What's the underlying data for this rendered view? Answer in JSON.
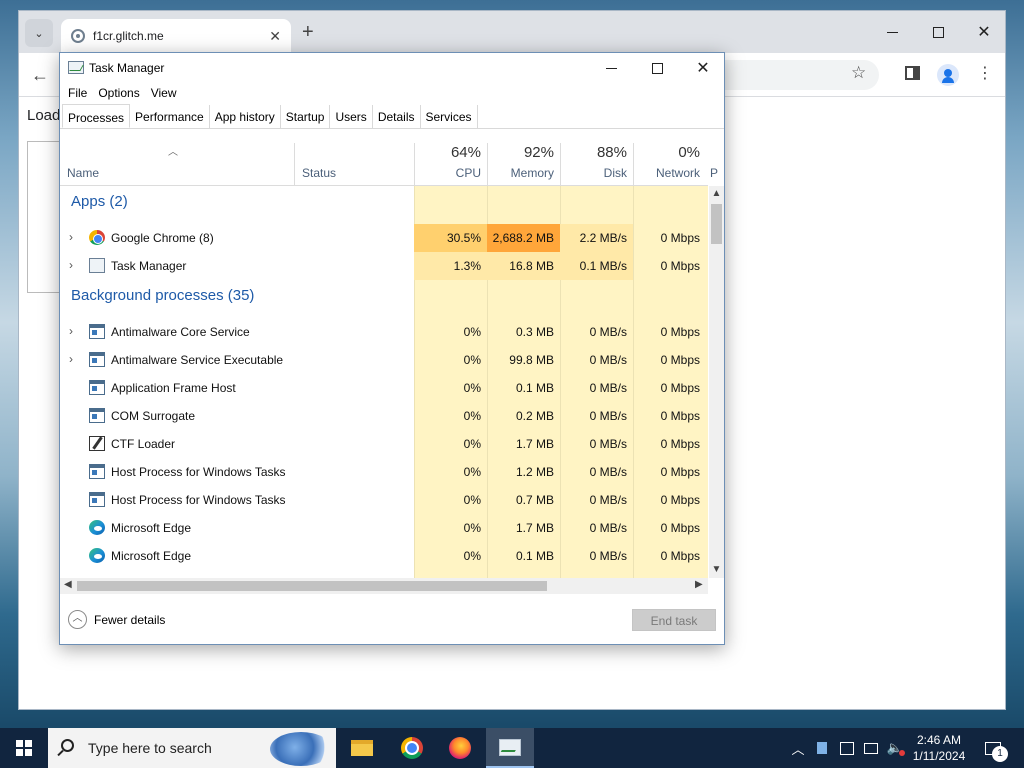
{
  "browser": {
    "tab_title": "f1cr.glitch.me",
    "tab_close": "✕",
    "new_tab": "+",
    "page_text": "Load"
  },
  "taskmgr": {
    "title": "Task Manager",
    "menu": [
      "File",
      "Options",
      "View"
    ],
    "tabs": [
      "Processes",
      "Performance",
      "App history",
      "Startup",
      "Users",
      "Details",
      "Services"
    ],
    "active_tab": "Processes",
    "columns": {
      "name": "Name",
      "status": "Status",
      "cpu": {
        "pct": "64%",
        "label": "CPU"
      },
      "memory": {
        "pct": "92%",
        "label": "Memory"
      },
      "disk": {
        "pct": "88%",
        "label": "Disk"
      },
      "network": {
        "pct": "0%",
        "label": "Network"
      },
      "power_partial": "P"
    },
    "groups": {
      "apps": "Apps (2)",
      "background": "Background processes (35)"
    },
    "apps": [
      {
        "name": "Google Chrome (8)",
        "icon": "chrome-icon",
        "expandable": true,
        "cpu": "30.5%",
        "memory": "2,688.2 MB",
        "disk": "2.2 MB/s",
        "network": "0 Mbps"
      },
      {
        "name": "Task Manager",
        "icon": "task-manager-icon",
        "expandable": true,
        "cpu": "1.3%",
        "memory": "16.8 MB",
        "disk": "0.1 MB/s",
        "network": "0 Mbps"
      }
    ],
    "background": [
      {
        "name": "Antimalware Core Service",
        "icon": "service-icon",
        "expandable": true,
        "cpu": "0%",
        "memory": "0.3 MB",
        "disk": "0 MB/s",
        "network": "0 Mbps"
      },
      {
        "name": "Antimalware Service Executable",
        "icon": "service-icon",
        "expandable": true,
        "cpu": "0%",
        "memory": "99.8 MB",
        "disk": "0 MB/s",
        "network": "0 Mbps"
      },
      {
        "name": "Application Frame Host",
        "icon": "service-icon",
        "expandable": false,
        "cpu": "0%",
        "memory": "0.1 MB",
        "disk": "0 MB/s",
        "network": "0 Mbps"
      },
      {
        "name": "COM Surrogate",
        "icon": "service-icon",
        "expandable": false,
        "cpu": "0%",
        "memory": "0.2 MB",
        "disk": "0 MB/s",
        "network": "0 Mbps"
      },
      {
        "name": "CTF Loader",
        "icon": "ctf-loader-icon",
        "expandable": false,
        "cpu": "0%",
        "memory": "1.7 MB",
        "disk": "0 MB/s",
        "network": "0 Mbps"
      },
      {
        "name": "Host Process for Windows Tasks",
        "icon": "service-icon",
        "expandable": false,
        "cpu": "0%",
        "memory": "1.2 MB",
        "disk": "0 MB/s",
        "network": "0 Mbps"
      },
      {
        "name": "Host Process for Windows Tasks",
        "icon": "service-icon",
        "expandable": false,
        "cpu": "0%",
        "memory": "0.7 MB",
        "disk": "0 MB/s",
        "network": "0 Mbps"
      },
      {
        "name": "Microsoft Edge",
        "icon": "edge-icon",
        "expandable": false,
        "cpu": "0%",
        "memory": "1.7 MB",
        "disk": "0 MB/s",
        "network": "0 Mbps"
      },
      {
        "name": "Microsoft Edge",
        "icon": "edge-icon",
        "expandable": false,
        "cpu": "0%",
        "memory": "0.1 MB",
        "disk": "0 MB/s",
        "network": "0 Mbps"
      }
    ],
    "footer": {
      "fewer_details": "Fewer details",
      "end_task": "End task"
    }
  },
  "taskbar": {
    "search_placeholder": "Type here to search",
    "time": "2:46 AM",
    "date": "1/11/2024",
    "notification_count": "1",
    "pinned_apps": [
      "file-explorer-icon",
      "chrome-icon",
      "firefox-icon",
      "task-manager-icon"
    ]
  }
}
